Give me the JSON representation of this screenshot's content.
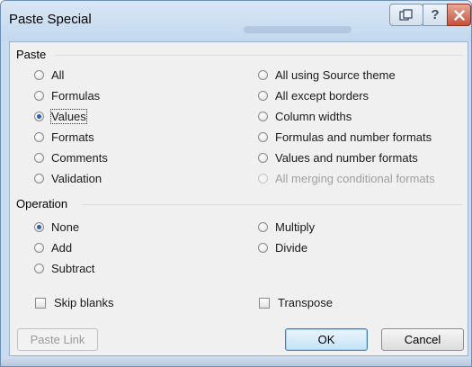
{
  "window": {
    "title": "Paste Special",
    "buttons": {
      "resize_icon": "restore-icon",
      "help_label": "?",
      "close_icon": "close-icon"
    }
  },
  "paste": {
    "group_label": "Paste",
    "left_options": [
      {
        "label": "All",
        "checked": false
      },
      {
        "label": "Formulas",
        "checked": false
      },
      {
        "label": "Values",
        "checked": true
      },
      {
        "label": "Formats",
        "checked": false
      },
      {
        "label": "Comments",
        "checked": false
      },
      {
        "label": "Validation",
        "checked": false
      }
    ],
    "right_options": [
      {
        "label": "All using Source theme",
        "checked": false
      },
      {
        "label": "All except borders",
        "checked": false
      },
      {
        "label": "Column widths",
        "checked": false
      },
      {
        "label": "Formulas and number formats",
        "checked": false
      },
      {
        "label": "Values and number formats",
        "checked": false
      },
      {
        "label": "All merging conditional formats",
        "checked": false,
        "disabled": true
      }
    ]
  },
  "operation": {
    "group_label": "Operation",
    "left_options": [
      {
        "label": "None",
        "checked": true
      },
      {
        "label": "Add",
        "checked": false
      },
      {
        "label": "Subtract",
        "checked": false
      }
    ],
    "right_options": [
      {
        "label": "Multiply",
        "checked": false
      },
      {
        "label": "Divide",
        "checked": false
      }
    ]
  },
  "checkboxes": {
    "skip_blanks": {
      "label": "Skip blanks",
      "checked": false
    },
    "transpose": {
      "label": "Transpose",
      "checked": false
    }
  },
  "buttons": {
    "paste_link": "Paste Link",
    "ok": "OK",
    "cancel": "Cancel"
  },
  "colors": {
    "title_bar": "#c9dcef",
    "close_button": "#c6513b",
    "radio_selected": "#2b5fb3",
    "default_button_border": "#3c7fb1"
  }
}
